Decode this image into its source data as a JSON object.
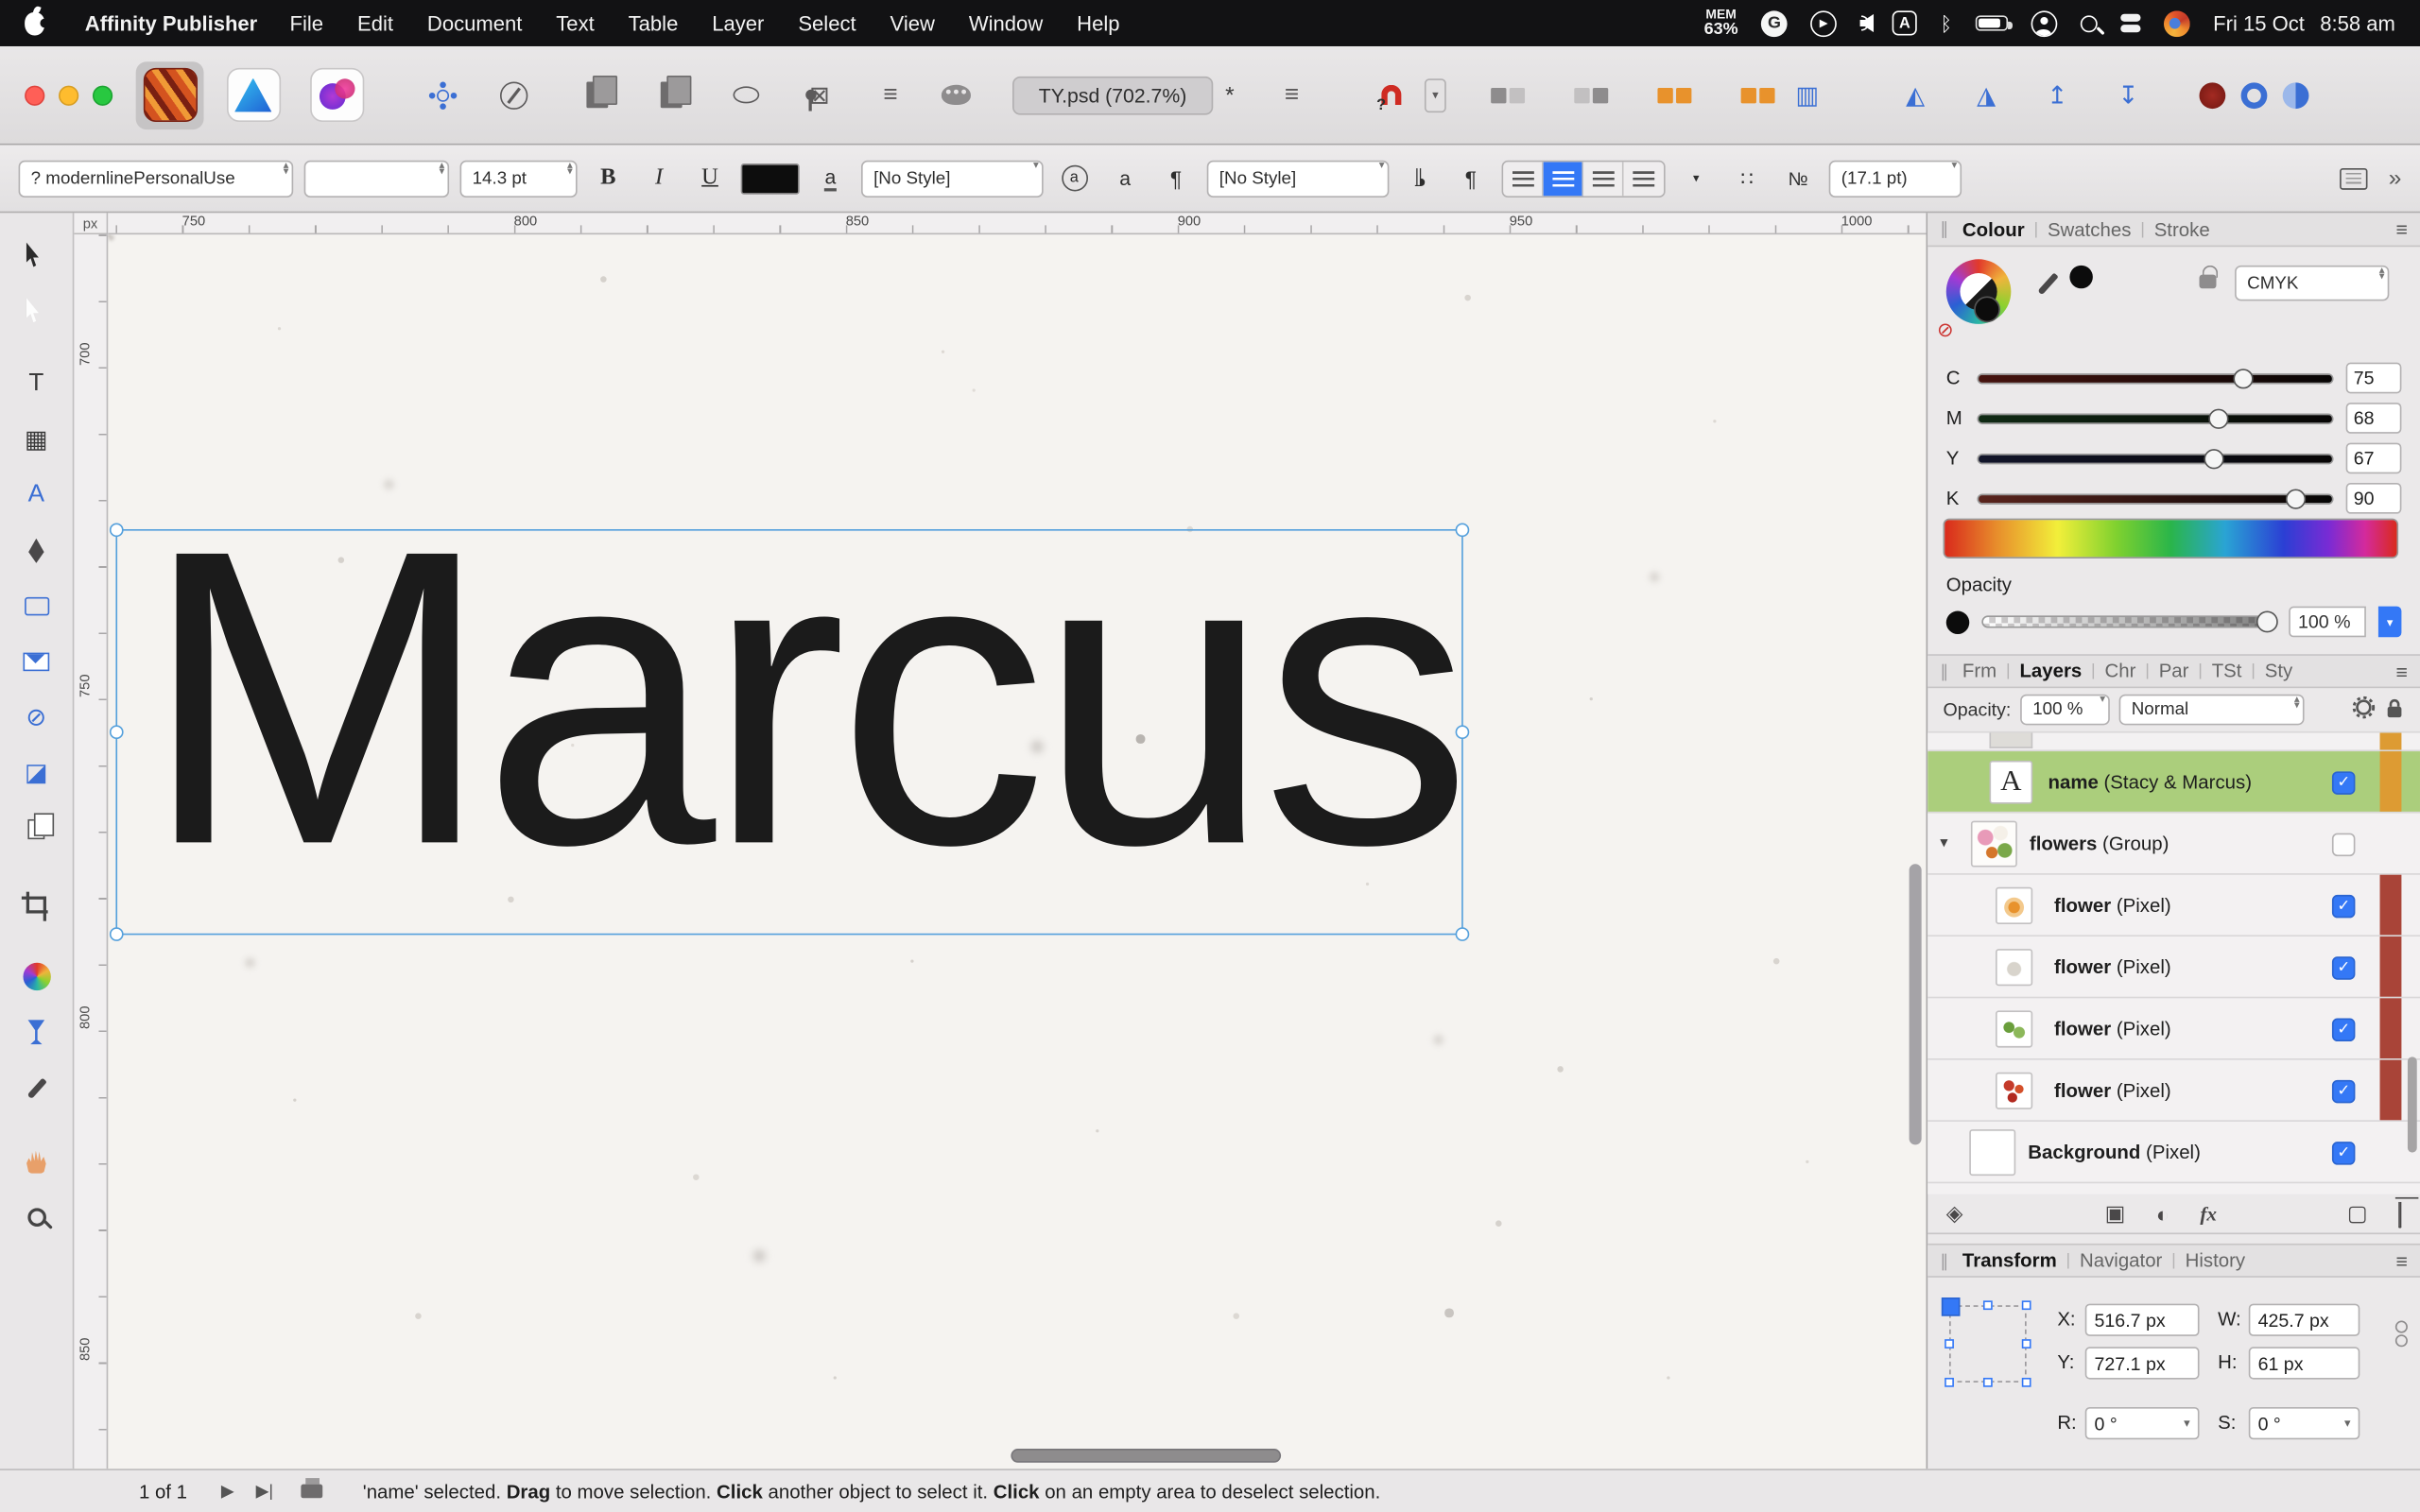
{
  "menu_bar": {
    "app_name": "Affinity Publisher",
    "menus": [
      "File",
      "Edit",
      "Document",
      "Text",
      "Table",
      "Layer",
      "Select",
      "View",
      "Window",
      "Help"
    ],
    "mem_label": "MEM",
    "mem_value": "63%",
    "date": "Fri 15 Oct",
    "time": "8:58 am"
  },
  "toolbar": {
    "document_tab": "TY.psd (702.7%)",
    "modified": "*"
  },
  "context_bar": {
    "font_name": "? modernlinePersonalUse",
    "font_size": "14.3 pt",
    "bold": "B",
    "italic": "I",
    "underline": "U",
    "char_style": "[No Style]",
    "para_style": "[No Style]",
    "leading": "(17.1 pt)"
  },
  "tools": [
    {
      "name": "move-tool"
    },
    {
      "name": "node-tool"
    },
    {
      "name": "frame-text-tool"
    },
    {
      "name": "table-tool"
    },
    {
      "name": "artistic-text-tool"
    },
    {
      "name": "pen-tool"
    },
    {
      "name": "rectangle-tool"
    },
    {
      "name": "picture-frame-tool"
    },
    {
      "name": "ellipse-frame-tool"
    },
    {
      "name": "place-image-tool"
    },
    {
      "name": "pages-tool"
    },
    {
      "name": "crop-tool"
    },
    {
      "name": "colour-wheel-tool"
    },
    {
      "name": "style-picker-tool"
    },
    {
      "name": "colour-picker-tool"
    },
    {
      "name": "view-tool"
    },
    {
      "name": "zoom-tool"
    }
  ],
  "rulers": {
    "unit": "px",
    "h_labels": [
      "750",
      "800",
      "850",
      "900",
      "950",
      "1000"
    ],
    "v_labels": [
      "700",
      "750",
      "800",
      "850"
    ]
  },
  "canvas": {
    "text": "Marcus"
  },
  "colour_panel": {
    "tabs": [
      "Colour",
      "Swatches",
      "Stroke"
    ],
    "active_tab": "Colour",
    "mode": "CMYK",
    "channels": [
      {
        "label": "C",
        "value": "75",
        "pct": 75
      },
      {
        "label": "M",
        "value": "68",
        "pct": 68
      },
      {
        "label": "Y",
        "value": "67",
        "pct": 67
      },
      {
        "label": "K",
        "value": "90",
        "pct": 90
      }
    ],
    "opacity_label": "Opacity",
    "opacity_value": "100 %"
  },
  "layers_panel": {
    "tabs": [
      "Frm",
      "Layers",
      "Chr",
      "Par",
      "TSt",
      "Sty"
    ],
    "active_tab": "Layers",
    "opacity_label": "Opacity:",
    "opacity_value": "100 %",
    "blend_mode": "Normal",
    "rows": [
      {
        "name": "name",
        "meta": " (Stacy & Marcus)",
        "selected": true,
        "checked": true,
        "tag": "orange",
        "thumb": "text",
        "disclosure": false
      },
      {
        "name": "flowers",
        "meta": " (Group)",
        "selected": false,
        "checked": false,
        "tag": "",
        "thumb": "flowers",
        "disclosure": true
      },
      {
        "name": "flower",
        "meta": " (Pixel)",
        "selected": false,
        "checked": true,
        "tag": "red",
        "thumb": "flower1",
        "disclosure": false
      },
      {
        "name": "flower",
        "meta": " (Pixel)",
        "selected": false,
        "checked": true,
        "tag": "red",
        "thumb": "flower2",
        "disclosure": false
      },
      {
        "name": "flower",
        "meta": " (Pixel)",
        "selected": false,
        "checked": true,
        "tag": "red",
        "thumb": "flower3",
        "disclosure": false
      },
      {
        "name": "flower",
        "meta": " (Pixel)",
        "selected": false,
        "checked": true,
        "tag": "red",
        "thumb": "flower4",
        "disclosure": false
      },
      {
        "name": "Background",
        "meta": " (Pixel)",
        "selected": false,
        "checked": true,
        "tag": "",
        "thumb": "background",
        "disclosure": false
      }
    ],
    "fx_label": "fx"
  },
  "transform_panel": {
    "tabs": [
      "Transform",
      "Navigator",
      "History"
    ],
    "active_tab": "Transform",
    "x_label": "X:",
    "x": "516.7 px",
    "w_label": "W:",
    "w": "425.7 px",
    "y_label": "Y:",
    "y": "727.1 px",
    "h_label": "H:",
    "h": "61 px",
    "r_label": "R:",
    "r": "0 °",
    "s_label": "S:",
    "s": "0 °"
  },
  "status_bar": {
    "page_indicator": "1 of 1",
    "hint": [
      {
        "t": "'name' selected. ",
        "b": 0
      },
      {
        "t": "Drag",
        "b": 1
      },
      {
        "t": " to move selection. ",
        "b": 0
      },
      {
        "t": "Click",
        "b": 1
      },
      {
        "t": " another object to select it. ",
        "b": 0
      },
      {
        "t": "Click",
        "b": 1
      },
      {
        "t": " on an empty area to deselect selection.",
        "b": 0
      }
    ]
  },
  "icons": {
    "play": "▶",
    "bluetooth": "ᛒ",
    "table": "▦",
    "xbox": "⊠",
    "ellipse-slash": "⊘",
    "image": "◪",
    "columns": "▥",
    "flip-h": "◭",
    "flip-v": "◮",
    "arrange-up": "↥",
    "arrange-down": "↧",
    "stack": "◈",
    "mask": "▣",
    "adjustment": "◐",
    "new-layer": "▢",
    "stepper-up": "▴",
    "stepper-down": "▾",
    "dropdown": "▾",
    "overflow": "»",
    "pilcrow": "¶",
    "bullets": "∷",
    "numbers": "№",
    "frame-text": "T",
    "artistic-text": "A",
    "check": "✓",
    "disclosure": "▾",
    "nav-next": "▶",
    "nav-end": "▶|",
    "menu": "≡",
    "handle": "∥",
    "rotate": "↺"
  },
  "colors": {
    "accent": "#3478f6",
    "selection": "#55a0dc",
    "layer_selected": "#abce7c",
    "tag_orange": "#dd9b33",
    "tag_red": "#a94438",
    "doc_text": "#1b1b1b"
  }
}
